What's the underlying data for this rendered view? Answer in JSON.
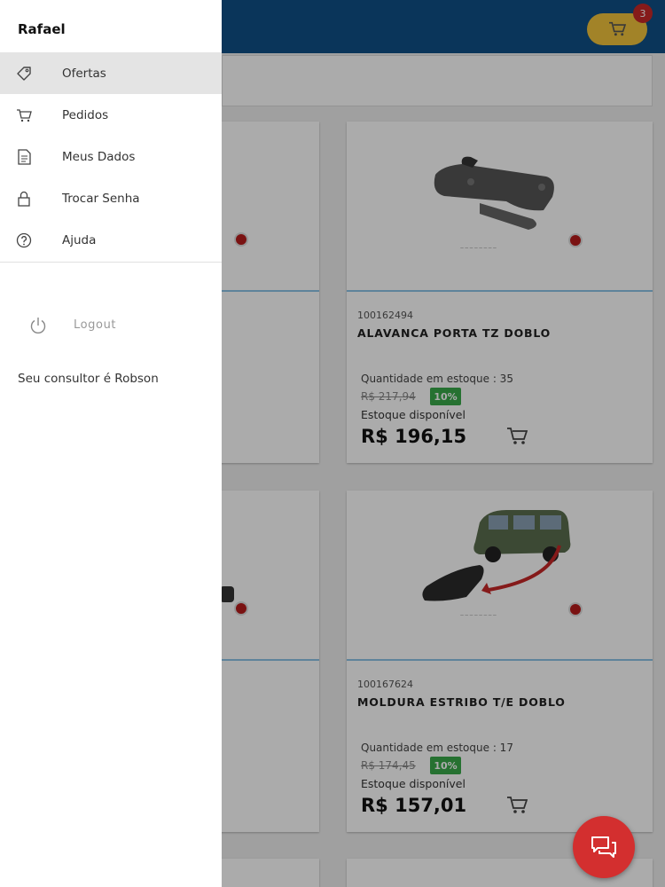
{
  "drawer": {
    "user_name": "Rafael",
    "menu": [
      {
        "label": "Ofertas",
        "icon": "tag-icon",
        "active": true
      },
      {
        "label": "Pedidos",
        "icon": "cart-icon",
        "active": false
      },
      {
        "label": "Meus Dados",
        "icon": "document-icon",
        "active": false
      },
      {
        "label": "Trocar Senha",
        "icon": "lock-icon",
        "active": false
      },
      {
        "label": "Ajuda",
        "icon": "help-icon",
        "active": false
      }
    ],
    "logout_label": "Logout",
    "consultant_text": "Seu consultor é Robson"
  },
  "header": {
    "cart_count": "3",
    "cart_icon": "cart-icon",
    "bar_color": "#0f4f86",
    "cart_button_color": "#f2c33c"
  },
  "products": [
    {
      "code": "100162494",
      "title": "ALAVANCA PORTA TZ DOBLO",
      "stock": "Quantidade em estoque : 35",
      "old_price": "R$ 217,94",
      "discount": "10%",
      "availability": "Estoque disponível",
      "price": "R$ 196,15"
    },
    {
      "code": "100167624",
      "title": "MOLDURA ESTRIBO T/E DOBLO",
      "stock": "Quantidade em estoque : 17",
      "old_price": "R$ 174,45",
      "discount": "10%",
      "availability": "Estoque disponível",
      "price": "R$ 157,01"
    }
  ],
  "fab": {
    "icon": "chat-icon",
    "color": "#d32f2f"
  }
}
